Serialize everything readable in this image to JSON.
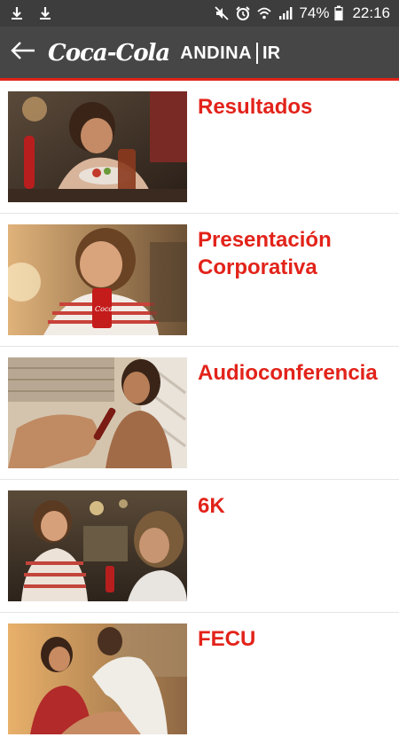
{
  "status_bar": {
    "battery": "74%",
    "time": "22:16",
    "icons": [
      "download-icon",
      "download-icon",
      "mute-icon",
      "alarm-icon",
      "wifi-icon",
      "signal-icon",
      "battery-icon"
    ]
  },
  "app_bar": {
    "logo_script": "Coca-Cola",
    "logo_brand": "ANDINA",
    "logo_ir": "IR",
    "back_icon": "arrow-left-icon"
  },
  "items": [
    {
      "title": "Resultados"
    },
    {
      "title": "Presentación Corporativa"
    },
    {
      "title": "Audioconferencia"
    },
    {
      "title": "6K"
    },
    {
      "title": "FECU"
    }
  ],
  "colors": {
    "accent": "#e2231a",
    "status_bar": "#3d3d3d",
    "app_bar": "#464646"
  }
}
